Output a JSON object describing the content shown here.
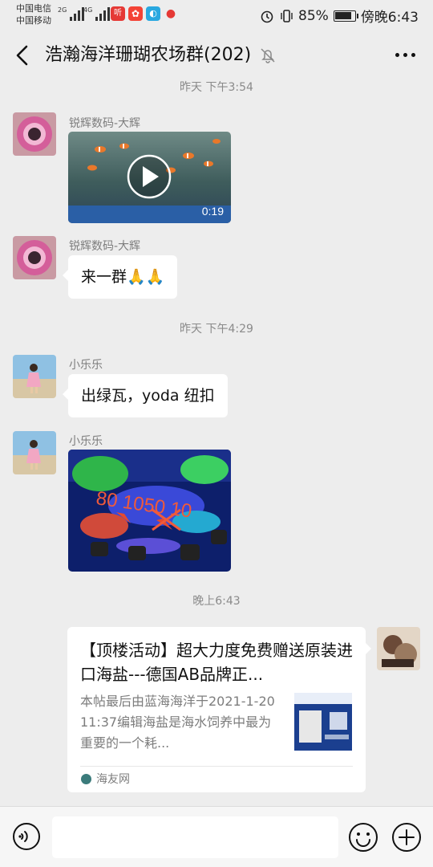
{
  "status_bar": {
    "carrier1": "中国电信",
    "carrier2": "中国移动",
    "sig1_tag": "2G",
    "sig2_tag": "4G",
    "app1": "听",
    "battery_percent": "85%",
    "time": "傍晚6:43"
  },
  "header": {
    "title": "浩瀚海洋珊瑚农场群(202)"
  },
  "messages": {
    "ts1": "昨天 下午3:54",
    "m1_nick": "锐辉数码-大辉",
    "m1_video_duration": "0:19",
    "m2_nick": "锐辉数码-大辉",
    "m2_text": "来一群🙏🙏",
    "ts2": "昨天 下午4:29",
    "m3_nick": "小乐乐",
    "m3_text": "出绿瓦，yoda 纽扣",
    "m4_nick": "小乐乐",
    "m4_overlay": "80 1050 10",
    "ts3": "晚上6:43"
  },
  "card": {
    "title": "【顶楼活动】超大力度免费赠送原装进口海盐---德国AB品牌正...",
    "desc": "本帖最后由蓝海海洋于2021-1-2011:37编辑海盐是海水饲养中最为重要的一个耗...",
    "source": "海友网"
  },
  "colors": {
    "background": "#ededed",
    "bubble": "#ffffff",
    "timestamp": "#8a8a8a"
  }
}
